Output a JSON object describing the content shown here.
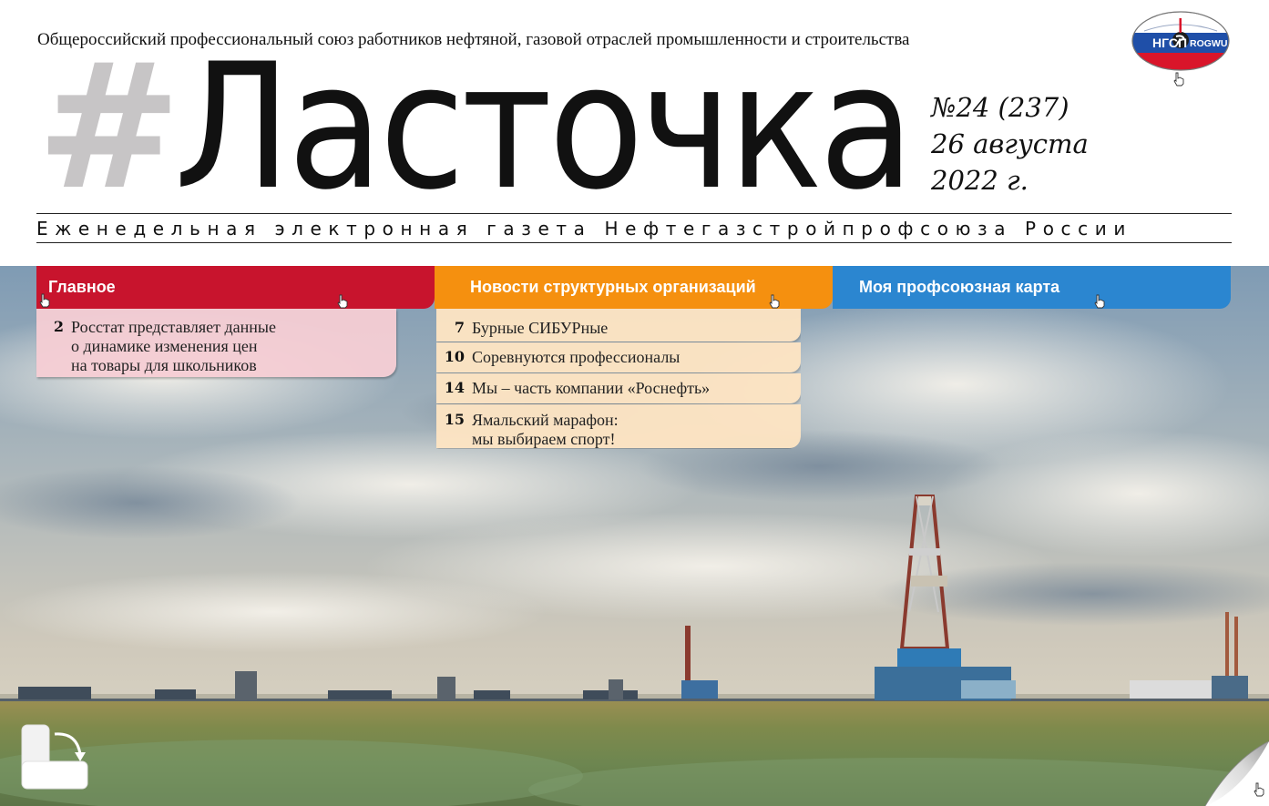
{
  "header": {
    "union_name": "Общероссийский профессиональный союз работников нефтяной, газовой отраслей промышленности и строительства",
    "logo": {
      "left_text": "НГСП",
      "right_text": "ROGWU",
      "icon": "union-globe-logo-icon"
    },
    "masthead_hash": "#",
    "masthead_word": "Ласточка",
    "issue_number": "№24 (237)",
    "issue_date": "26 августа",
    "issue_year": "2022 г.",
    "subtitle": "Еженедельная электронная газета Нефтегазстройпрофсоюза России"
  },
  "nav": {
    "tabs": [
      {
        "label": "Главное",
        "color": "#c8142d"
      },
      {
        "label": "Новости структурных организаций",
        "color": "#f5900f"
      },
      {
        "label": "Моя профсоюзная карта",
        "color": "#2b86d0"
      }
    ]
  },
  "main_panel": {
    "items": [
      {
        "page": "2",
        "lines": [
          "Росстат представляет данные",
          "о динамике изменения цен",
          "на товары для школьников"
        ]
      }
    ]
  },
  "news_panel": {
    "items": [
      {
        "page": "7",
        "lines": [
          "Бурные СИБУРные"
        ]
      },
      {
        "page": "10",
        "lines": [
          "Соревнуются профессионалы"
        ]
      },
      {
        "page": "14",
        "lines": [
          "Мы – часть компании «Роснефть»"
        ]
      },
      {
        "page": "15",
        "lines": [
          "Ямальский марафон:",
          "мы выбираем спорт!"
        ]
      }
    ]
  },
  "widgets": {
    "rotate_icon": "rotate-page-icon",
    "curl_icon": "page-curl-icon",
    "cursor_icon": "hand-cursor-icon"
  }
}
